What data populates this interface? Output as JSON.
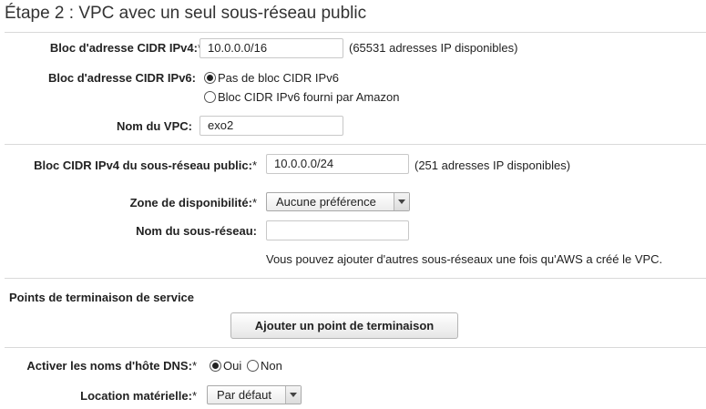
{
  "page": {
    "title": "Étape 2 : VPC avec un seul sous-réseau public"
  },
  "vpc": {
    "cidr_ipv4": {
      "label": "Bloc d'adresse CIDR IPv4:",
      "required": "*",
      "value": "10.0.0.0/16",
      "hint": "(65531 adresses IP disponibles)"
    },
    "cidr_ipv6": {
      "label": "Bloc d'adresse CIDR IPv6:",
      "options": [
        {
          "label": "Pas de bloc CIDR IPv6",
          "selected": true
        },
        {
          "label": "Bloc CIDR IPv6 fourni par Amazon",
          "selected": false
        }
      ]
    },
    "name": {
      "label": "Nom du VPC:",
      "value": "exo2"
    }
  },
  "subnet": {
    "cidr_ipv4": {
      "label": "Bloc CIDR IPv4 du sous-réseau public:",
      "required": "*",
      "value": "10.0.0.0/24",
      "hint": "(251 adresses IP disponibles)"
    },
    "az": {
      "label": "Zone de disponibilité:",
      "required": "*",
      "value": "Aucune préférence"
    },
    "name": {
      "label": "Nom du sous-réseau:",
      "value": ""
    },
    "note": "Vous pouvez ajouter d'autres sous-réseaux une fois qu'AWS a créé le VPC."
  },
  "endpoints": {
    "heading": "Points de terminaison de service",
    "add_button": "Ajouter un point de terminaison"
  },
  "dns": {
    "label": "Activer les noms d'hôte DNS:",
    "required": "*",
    "options": [
      {
        "label": "Oui",
        "selected": true
      },
      {
        "label": "Non",
        "selected": false
      }
    ]
  },
  "tenancy": {
    "label": "Location matérielle:",
    "required": "*",
    "value": "Par défaut"
  }
}
